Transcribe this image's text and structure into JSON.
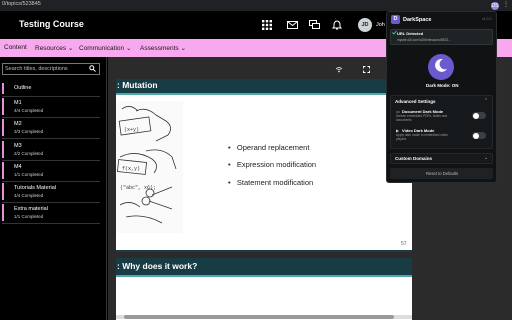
{
  "browser": {
    "url": "0/topics/523845",
    "extension_badge": "DS",
    "menu_icon": "kebab-icon"
  },
  "header": {
    "course_title": "Testing Course",
    "icons": [
      "grid-icon",
      "mail-icon",
      "chat-icon",
      "bell-icon"
    ],
    "avatar_initials": "JD",
    "user_name": "Joh"
  },
  "nav": {
    "items": [
      "Content",
      "Resources ⌄",
      "Communication ⌄",
      "Assessments ⌄"
    ]
  },
  "sidebar": {
    "search_placeholder": "Search titles, descriptions",
    "outline_label": "Outline",
    "items": [
      {
        "title": "M1",
        "status": "4/4 Completed"
      },
      {
        "title": "M2",
        "status": "3/3 Completed"
      },
      {
        "title": "M3",
        "status": "2/2 Completed"
      },
      {
        "title": "M4",
        "status": "1/1 Completed"
      },
      {
        "title": "Tutorials Material",
        "status": "4/4 Completed"
      },
      {
        "title": "Extra material",
        "status": "1/1 Completed"
      }
    ]
  },
  "slides": {
    "slide1_title": ": Mutation",
    "bullets": [
      "Operand replacement",
      "Expression modification",
      "Statement modification"
    ],
    "slide1_number": "57",
    "slide2_title": ": Why does it work?"
  },
  "popup": {
    "title": "DarkSpace",
    "version": "v1.0.0",
    "url_status": "URL Detected",
    "url_value": "mysite.d2l.com/d2l/le/lessons/6523...",
    "mode_status": "Dark Mode: ON",
    "advanced_title": "Advanced Settings",
    "option1_title": "Document Dark Mode",
    "option1_desc_1": "Darken embedded PDFs, slides and",
    "option1_desc_2": "documents",
    "option2_title": "Video Dark Mode",
    "option2_desc_1": "Apply dark mode to embedded video",
    "option2_desc_2": "players",
    "domains_title": "Custom Domains",
    "reset_label": "Reset to Defaults",
    "option1_on": false,
    "option2_on": false
  },
  "colors": {
    "nav_bg": "#f7a8ee",
    "slide_header": "#183c44",
    "accent": "#6a5acd"
  }
}
